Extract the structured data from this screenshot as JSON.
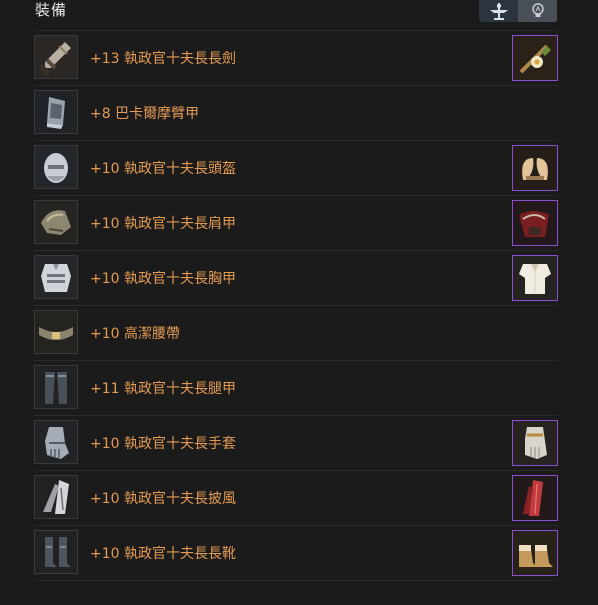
{
  "header": {
    "title": "裝備",
    "toggle": {
      "options": [
        {
          "icon": "armor-stand-icon",
          "active": true
        },
        {
          "icon": "lightbulb-icon",
          "active": false
        }
      ]
    }
  },
  "colors": {
    "item_name": "#e39a52",
    "costume_border": "#8a4fd3",
    "background": "#1b1b1b"
  },
  "equipment": [
    {
      "name": "+13 執政官十夫長長劍",
      "icon": "longsword-icon",
      "costume_icon": "flower-sword-costume-icon"
    },
    {
      "name": "+8 巴卡爾摩臂甲",
      "icon": "vambrace-icon",
      "costume_icon": null
    },
    {
      "name": "+10 執政官十夫長頭盔",
      "icon": "helmet-icon",
      "costume_icon": "horned-headband-costume-icon"
    },
    {
      "name": "+10 執政官十夫長肩甲",
      "icon": "pauldron-icon",
      "costume_icon": "red-shoulder-costume-icon"
    },
    {
      "name": "+10 執政官十夫長胸甲",
      "icon": "chest-armor-icon",
      "costume_icon": "white-shirt-costume-icon"
    },
    {
      "name": "+10 高潔腰帶",
      "icon": "belt-icon",
      "costume_icon": null
    },
    {
      "name": "+11 執政官十夫長腿甲",
      "icon": "leg-armor-icon",
      "costume_icon": null
    },
    {
      "name": "+10 執政官十夫長手套",
      "icon": "gauntlet-icon",
      "costume_icon": "glove-costume-icon"
    },
    {
      "name": "+10 執政官十夫長披風",
      "icon": "cape-icon",
      "costume_icon": "red-cape-costume-icon"
    },
    {
      "name": "+10 執政官十夫長長靴",
      "icon": "boots-icon",
      "costume_icon": "fur-boots-costume-icon"
    }
  ]
}
